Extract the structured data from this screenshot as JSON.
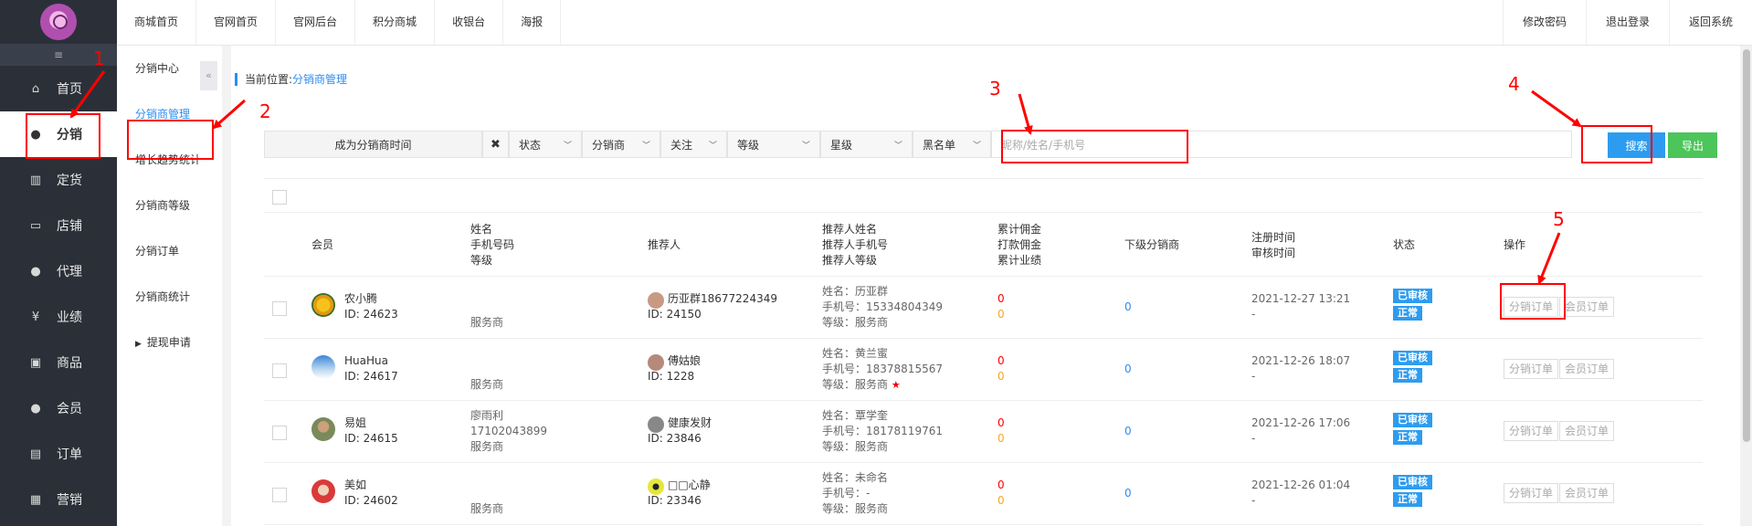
{
  "sidebar": {
    "collapse_icon": "menu-collapse-icon",
    "items": [
      {
        "label": "首页",
        "icon": "home-icon"
      },
      {
        "label": "分销",
        "icon": "user-icon"
      },
      {
        "label": "定货",
        "icon": "bar-chart-icon"
      },
      {
        "label": "店铺",
        "icon": "store-icon"
      },
      {
        "label": "代理",
        "icon": "user-icon"
      },
      {
        "label": "业绩",
        "icon": "yen-icon"
      },
      {
        "label": "商品",
        "icon": "product-icon"
      },
      {
        "label": "会员",
        "icon": "user-icon"
      },
      {
        "label": "订单",
        "icon": "document-icon"
      },
      {
        "label": "营销",
        "icon": "gift-icon"
      }
    ]
  },
  "topbar": {
    "tabs": [
      "商城首页",
      "官网首页",
      "官网后台",
      "积分商城",
      "收银台",
      "海报"
    ],
    "right": [
      "修改密码",
      "退出登录",
      "返回系统"
    ]
  },
  "subnav": {
    "items": [
      "分销中心",
      "分销商管理",
      "增长趋势统计",
      "分销商等级",
      "分销订单",
      "分销商统计",
      "提现申请"
    ],
    "toggle": "«"
  },
  "breadcrumb": {
    "prefix": "当前位置:",
    "current": "分销商管理"
  },
  "filters": {
    "date_label": "成为分销商时间",
    "clear": "✖",
    "selects": [
      "状态",
      "分销商",
      "关注",
      "等级",
      "星级",
      "黑名单"
    ],
    "search_placeholder": "昵称/姓名/手机号",
    "search_button": "搜索",
    "export_button": "导出"
  },
  "table": {
    "headers": {
      "member": "会员",
      "name": [
        "姓名",
        "手机号码",
        "等级"
      ],
      "referrer": "推荐人",
      "ref_info": [
        "推荐人姓名",
        "推荐人手机号",
        "推荐人等级"
      ],
      "commission": [
        "累计佣金",
        "打款佣金",
        "累计业绩"
      ],
      "sub": "下级分销商",
      "time": [
        "注册时间",
        "审核时间"
      ],
      "status": "状态",
      "op": "操作"
    },
    "rows": [
      {
        "nick": "农小腾",
        "id": "ID: 24623",
        "name": "",
        "phone": "",
        "level": "服务商",
        "ref_nick": "历亚群18677224349",
        "ref_id": "ID: 24150",
        "ref_name": "姓名：历亚群",
        "ref_phone": "手机号：15334804349",
        "ref_level": "等级：服务商",
        "ref_star": "",
        "c1": "0",
        "c2": "0",
        "sub": "0",
        "reg": "2021-12-27 13:21",
        "audit": "-",
        "tag1": "已审核",
        "tag2": "正常",
        "op1": "分销订单",
        "op2": "会员订单"
      },
      {
        "nick": "HuaHua",
        "id": "ID: 24617",
        "name": "",
        "phone": "",
        "level": "服务商",
        "ref_nick": "傅姑娘",
        "ref_id": "ID: 1228",
        "ref_name": "姓名：黄兰蜜",
        "ref_phone": "手机号：18378815567",
        "ref_level": "等级：服务商",
        "ref_star": "★",
        "c1": "0",
        "c2": "0",
        "sub": "0",
        "reg": "2021-12-26 18:07",
        "audit": "-",
        "tag1": "已审核",
        "tag2": "正常",
        "op1": "分销订单",
        "op2": "会员订单"
      },
      {
        "nick": "易姐",
        "id": "ID: 24615",
        "name": "廖雨利",
        "phone": "17102043899",
        "level": "服务商",
        "ref_nick": "健康发财",
        "ref_id": "ID: 23846",
        "ref_name": "姓名：覃学奎",
        "ref_phone": "手机号：18178119761",
        "ref_level": "等级：服务商",
        "ref_star": "",
        "c1": "0",
        "c2": "0",
        "sub": "0",
        "reg": "2021-12-26 17:06",
        "audit": "-",
        "tag1": "已审核",
        "tag2": "正常",
        "op1": "分销订单",
        "op2": "会员订单"
      },
      {
        "nick": "美如",
        "id": "ID: 24602",
        "name": "",
        "phone": "",
        "level": "服务商",
        "ref_nick": "□□心静",
        "ref_id": "ID: 23346",
        "ref_name": "姓名：未命名",
        "ref_phone": "手机号：-",
        "ref_level": "等级：服务商",
        "ref_star": "",
        "c1": "0",
        "c2": "0",
        "sub": "0",
        "reg": "2021-12-26 01:04",
        "audit": "-",
        "tag1": "已审核",
        "tag2": "正常",
        "op1": "分销订单",
        "op2": "会员订单"
      }
    ]
  },
  "annotations": [
    "1",
    "2",
    "3",
    "4",
    "5"
  ]
}
